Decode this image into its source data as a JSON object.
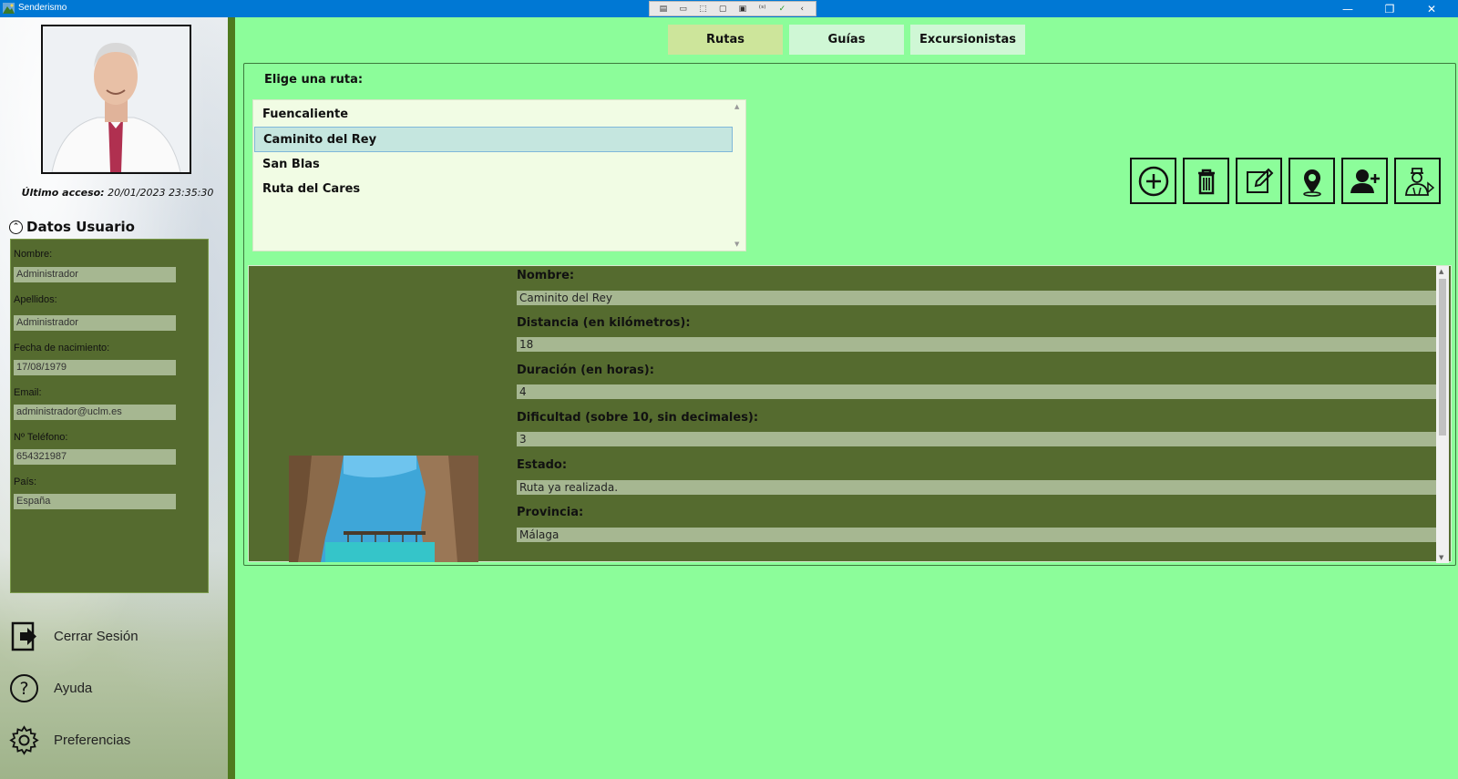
{
  "window": {
    "title": "Senderismo"
  },
  "sidebar": {
    "last_access_label": "Último acceso:",
    "last_access_value": "20/01/2023 23:35:30",
    "section_title": "Datos Usuario",
    "fields": [
      {
        "label": "Nombre:",
        "value": "Administrador"
      },
      {
        "label": "Apellidos:",
        "value": "Administrador"
      },
      {
        "label": "Fecha de nacimiento:",
        "value": "17/08/1979"
      },
      {
        "label": "Email:",
        "value": "administrador@uclm.es"
      },
      {
        "label": "Nº Teléfono:",
        "value": "654321987"
      },
      {
        "label": "País:",
        "value": "España"
      }
    ],
    "actions": [
      {
        "label": "Cerrar Sesión",
        "icon": "logout-icon"
      },
      {
        "label": "Ayuda",
        "icon": "help-icon"
      },
      {
        "label": "Preferencias",
        "icon": "gear-icon"
      }
    ]
  },
  "tabs": [
    {
      "label": "Rutas",
      "active": true
    },
    {
      "label": "Guías",
      "active": false
    },
    {
      "label": "Excursionistas",
      "active": false
    }
  ],
  "routes": {
    "label": "Elige una ruta:",
    "items": [
      "Fuencaliente",
      "Caminito del Rey",
      "San Blas",
      "Ruta del Cares"
    ],
    "selected_index": 1
  },
  "toolbar": {
    "buttons": [
      "add-icon",
      "trash-icon",
      "edit-icon",
      "location-pin-icon",
      "add-user-icon",
      "guide-assign-icon"
    ]
  },
  "details": {
    "fields": [
      {
        "label": "Nombre:",
        "value": "Caminito del Rey"
      },
      {
        "label": "Distancia (en kilómetros):",
        "value": "18"
      },
      {
        "label": "Duración (en horas):",
        "value": "4"
      },
      {
        "label": "Dificultad (sobre 10, sin decimales):",
        "value": "3"
      },
      {
        "label": "Estado:",
        "value": "Ruta ya realizada."
      },
      {
        "label": "Provincia:",
        "value": "Málaga"
      }
    ]
  },
  "colors": {
    "background": "#8cfd9a",
    "panel": "#556b2f",
    "field": "#a6b791",
    "tab_active": "#cde59b",
    "titlebar": "#0078d4"
  }
}
